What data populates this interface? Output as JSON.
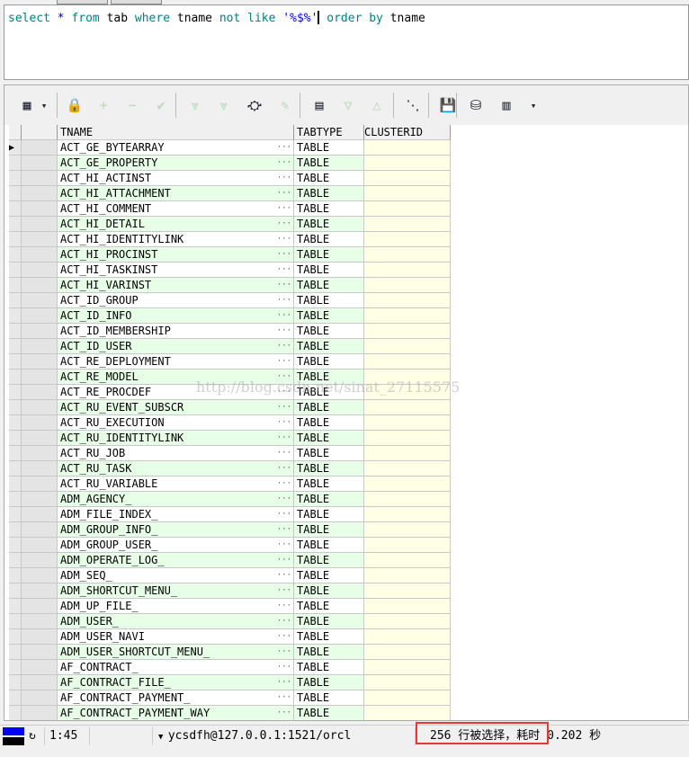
{
  "editor": {
    "sql": [
      {
        "t": "select",
        "c": "kw"
      },
      {
        "t": " * ",
        "c": "op"
      },
      {
        "t": "from",
        "c": "kw"
      },
      {
        "t": " tab ",
        "c": ""
      },
      {
        "t": "where",
        "c": "kw"
      },
      {
        "t": " tname ",
        "c": ""
      },
      {
        "t": "not like",
        "c": "kw"
      },
      {
        "t": " '%$%'",
        "c": "str"
      },
      {
        "t": "|",
        "c": "cursor"
      },
      {
        "t": " order by",
        "c": "kw"
      },
      {
        "t": " tname",
        "c": ""
      }
    ]
  },
  "toolbar": [
    {
      "icon": "grid-icon",
      "g": "▦"
    },
    {
      "icon": "dropdown-icon",
      "g": "▾"
    },
    {
      "icon": "lock-icon",
      "g": "🔒"
    },
    {
      "icon": "add-icon",
      "g": "+"
    },
    {
      "icon": "remove-icon",
      "g": "−"
    },
    {
      "icon": "check-icon",
      "g": "✔"
    },
    {
      "icon": "fetch-next-icon",
      "g": "⩔"
    },
    {
      "icon": "fetch-all-icon",
      "g": "⩔"
    },
    {
      "icon": "find-icon",
      "g": "⛮"
    },
    {
      "icon": "clear-icon",
      "g": "✎"
    },
    {
      "icon": "query-icon",
      "g": "▤"
    },
    {
      "icon": "arrow-down-icon",
      "g": "▽"
    },
    {
      "icon": "arrow-up-icon",
      "g": "△"
    },
    {
      "icon": "tree-icon",
      "g": "⋱"
    },
    {
      "icon": "save-icon",
      "g": "💾"
    },
    {
      "icon": "export-icon",
      "g": "⛁"
    },
    {
      "icon": "chart-icon",
      "g": "▥"
    },
    {
      "icon": "dropdown-icon",
      "g": "▾"
    }
  ],
  "grid": {
    "columns": [
      "TNAME",
      "TABTYPE",
      "CLUSTERID"
    ],
    "rows": [
      "ACT_GE_BYTEARRAY",
      "ACT_GE_PROPERTY",
      "ACT_HI_ACTINST",
      "ACT_HI_ATTACHMENT",
      "ACT_HI_COMMENT",
      "ACT_HI_DETAIL",
      "ACT_HI_IDENTITYLINK",
      "ACT_HI_PROCINST",
      "ACT_HI_TASKINST",
      "ACT_HI_VARINST",
      "ACT_ID_GROUP",
      "ACT_ID_INFO",
      "ACT_ID_MEMBERSHIP",
      "ACT_ID_USER",
      "ACT_RE_DEPLOYMENT",
      "ACT_RE_MODEL",
      "ACT_RE_PROCDEF",
      "ACT_RU_EVENT_SUBSCR",
      "ACT_RU_EXECUTION",
      "ACT_RU_IDENTITYLINK",
      "ACT_RU_JOB",
      "ACT_RU_TASK",
      "ACT_RU_VARIABLE",
      "ADM_AGENCY_",
      "ADM_FILE_INDEX_",
      "ADM_GROUP_INFO_",
      "ADM_GROUP_USER_",
      "ADM_OPERATE_LOG_",
      "ADM_SEQ_",
      "ADM_SHORTCUT_MENU_",
      "ADM_UP_FILE_",
      "ADM_USER_",
      "ADM_USER_NAVI",
      "ADM_USER_SHORTCUT_MENU_",
      "AF_CONTRACT_",
      "AF_CONTRACT_FILE_",
      "AF_CONTRACT_PAYMENT_",
      "AF_CONTRACT_PAYMENT_WAY"
    ],
    "tabtype": "TABLE",
    "row_colors": [
      "#ffffff",
      "#e6ffe6"
    ],
    "clusterid_color": "#ffffe6"
  },
  "watermark": "http://blog.csdn.net/sinat_27115575",
  "status": {
    "position": "1:45",
    "connection": "ycsdfh@127.0.0.1:1521/orcl",
    "message": "256 行被选择，耗时 0.202 秒"
  }
}
